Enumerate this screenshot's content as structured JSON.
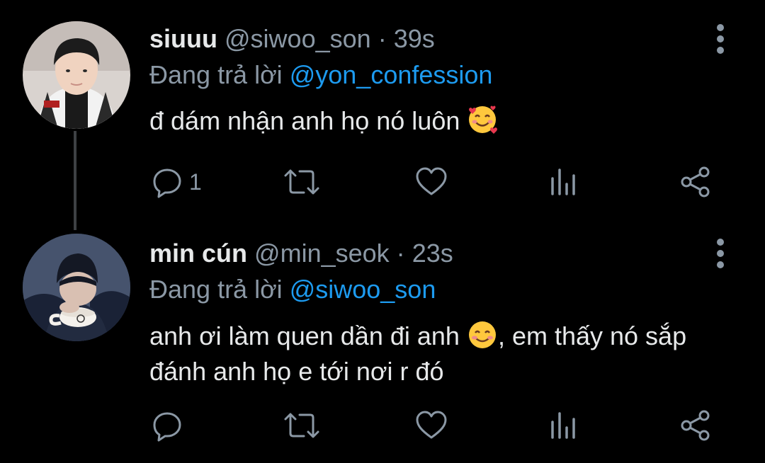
{
  "thread": {
    "tweets": [
      {
        "name": "siuuu",
        "handle": "@siwoo_son",
        "separator": "·",
        "time": "39s",
        "reply_prefix": "Đang trả lời",
        "reply_to": "@yon_confession",
        "text": "đ dám nhận anh họ nó luôn",
        "emoji": "smiling-face-with-hearts",
        "reply_count": "1",
        "avatar": "profile-photo"
      },
      {
        "name": "min cún",
        "handle": "@min_seok",
        "separator": "·",
        "time": "23s",
        "reply_prefix": "Đang trả lời",
        "reply_to": "@siwoo_son",
        "text_part1": "anh ơi làm quen dần đi anh",
        "emoji": "smiling-face-with-smiling-eyes",
        "text_part2": ", em thấy nó sắp đánh anh họ e tới nơi r đó",
        "reply_count": "",
        "avatar": "profile-photo"
      }
    ]
  },
  "colors": {
    "background": "#000000",
    "text": "#e7e9ea",
    "secondary": "#8b98a5",
    "link": "#1d9bf0",
    "thread_line": "#3e4144"
  },
  "icons": [
    "more-vertical-icon",
    "reply-icon",
    "retweet-icon",
    "like-icon",
    "analytics-icon",
    "share-icon"
  ]
}
